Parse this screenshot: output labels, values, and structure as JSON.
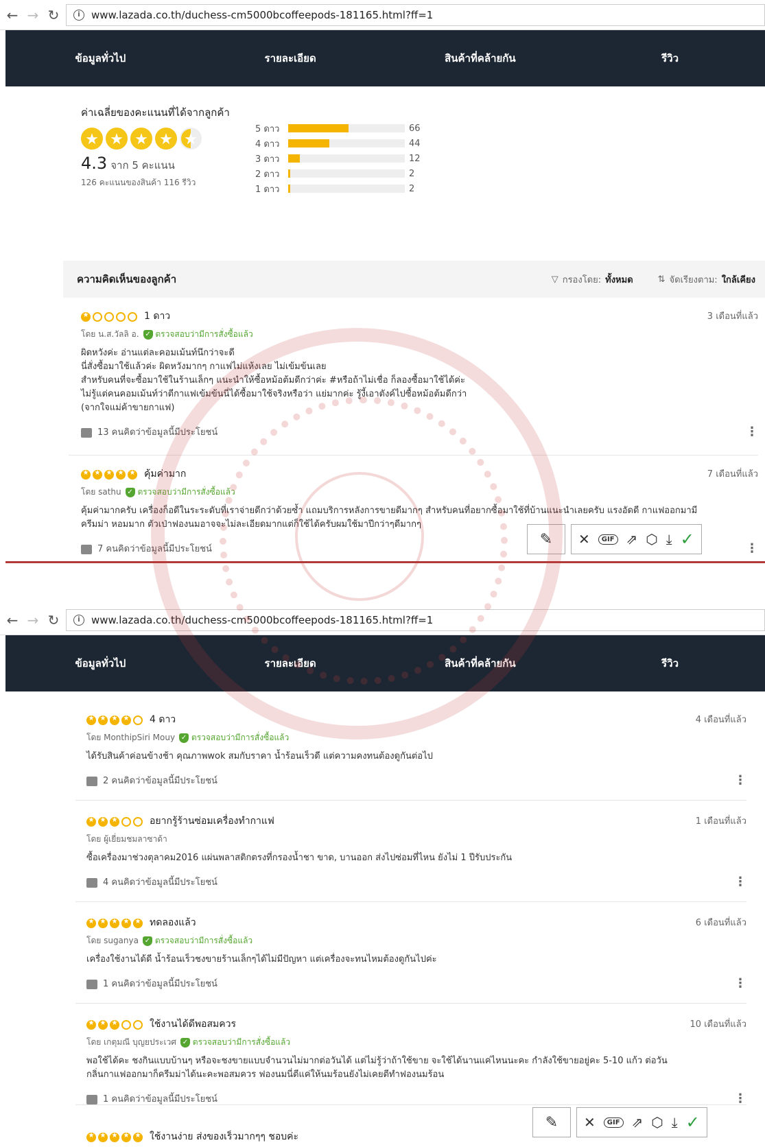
{
  "screen1": {
    "url": "www.lazada.co.th/duchess-cm5000bcoffeepods-181165.html?ff=1",
    "tabs": [
      "ข้อมูลทั่วไป",
      "รายละเอียด",
      "สินค้าที่คล้ายกัน",
      "รีวิว"
    ],
    "rating": {
      "heading": "ค่าเฉลี่ยของคะแนนที่ได้จากลูกค้า",
      "score": "4.3",
      "score_suffix": "จาก 5 คะแนน",
      "summary": "126 คะแนนของสินค้า 116 รีวิว",
      "stars": 4.3,
      "breakdown": [
        {
          "label": "5 ดาว",
          "count": 66,
          "fraction": 0.52
        },
        {
          "label": "4 ดาว",
          "count": 44,
          "fraction": 0.35
        },
        {
          "label": "3 ดาว",
          "count": 12,
          "fraction": 0.1
        },
        {
          "label": "2 ดาว",
          "count": 2,
          "fraction": 0.02
        },
        {
          "label": "1 ดาว",
          "count": 2,
          "fraction": 0.02
        }
      ]
    },
    "reviews_header": {
      "title": "ความคิดเห็นของลูกค้า",
      "filter_label": "กรองโดย:",
      "filter_value": "ทั้งหมด",
      "sort_label": "จัดเรียงตาม:",
      "sort_value": "ใกล้เคียง"
    },
    "reviews": [
      {
        "stars": 1,
        "title": "1 ดาว",
        "date": "3 เดือนที่แล้ว",
        "by": "โดย น.ส.วัลลิ อ.",
        "verified": "ตรวจสอบว่ามีการสั่งซื้อแล้ว",
        "body": "ผิดหวังค่ะ อ่านแต่ละคอมเม้นท์นึกว่าจะดี\nนี่สั่งซื้อมาใช้แล้วค่ะ ผิดหวังมากๆ กาแฟไม่แห้งเลย ไม่เข้มข้นเลย\nสำหรับคนที่จะซื้อมาใช้ในร้านเล็กๆ แนะนำให้ซื้อหม้อต้มดีกว่าค่ะ #หรือถ้าไม่เชื่อ ก็ลองซื้อมาใช้ได้ค่ะ\nไม่รู้แต่คนคอมเม้นท์ว่าตีกาแฟเข้มข้นนี่ได้ซื้อมาใช้จริงหรือว่า แย่มากค่ะ รู้งี้เอาตังค์ไปซื้อหม้อต้มดีกว่า\n(จากใจแม่ค้าขายกาแฟ)",
        "helpful": "13 คนคิดว่าข้อมูลนี้มีประโยชน์"
      },
      {
        "stars": 5,
        "title": "คุ้มค่ามาก",
        "date": "7 เดือนที่แล้ว",
        "by": "โดย sathu",
        "verified": "ตรวจสอบว่ามีการสั่งซื้อแล้ว",
        "body": "คุ้มค่ามากครับ เครื่องก็อดีในระระดับ​ที่เราจ่ายดีกว่าด้วยซ้ำ แถมบริการหลังการขายดีมากๆ สำหรับคนที่อยากซื้อมาใช้ที่บ้านแนะนำเลยครับ แรงอัดดี กาแฟออกมามี\nครีมม่า หอมมาก ตัวเป่าฟองนมอาจจะไม่ละเอียดมากแต่ก็ใช้ได้ครับผมใช้มาปีกว่าๆดีมากๆ",
        "helpful": "7 คนคิดว่าข้อมูลนี้มีประโยชน์"
      }
    ]
  },
  "screen2": {
    "url": "www.lazada.co.th/duchess-cm5000bcoffeepods-181165.html?ff=1",
    "tabs": [
      "ข้อมูลทั่วไป",
      "รายละเอียด",
      "สินค้าที่คล้ายกัน",
      "รีวิว"
    ],
    "reviews": [
      {
        "stars": 4,
        "title": "4 ดาว",
        "date": "4 เดือนที่แล้ว",
        "by": "โดย MonthipSiri Mouy",
        "verified": "ตรวจสอบว่ามีการสั่งซื้อแล้ว",
        "body": "ได้รับสินค้าค่อนข้างช้า คุณภาพwok สมกับราคา น้ำร้อนเร็วดี แต่ความคงทนต้องดูกันต่อไป",
        "helpful": "2 คนคิดว่าข้อมูลนี้มีประโยชน์"
      },
      {
        "stars": 3,
        "title": "อยากรู้ร้านซ่อมเครื่องทำกาแฟ",
        "date": "1 เดือนที่แล้ว",
        "by": "โดย ผู้เยี่ยมชมลาซาด้า",
        "verified": "",
        "body": "ซื้อเครื่องมาช่วงตุลาคม2016 แผ่นพลาสติกตรงที่กรองน้ำชา ขาด, บานออก ส่งไปซ่อมที่ไหน ยังไม่ 1 ปีรับประกัน",
        "helpful": "4 คนคิดว่าข้อมูลนี้มีประโยชน์"
      },
      {
        "stars": 5,
        "title": "ทดลองแล้ว",
        "date": "6 เดือนที่แล้ว",
        "by": "โดย suganya",
        "verified": "ตรวจสอบว่ามีการสั่งซื้อแล้ว",
        "body": "เครื่องใช้งานได้ดี น้ำร้อนเร็วชงขายร้านเล็กๆได้ไม่มีปัญหา แต่เครื่องจะทนไหมต้องดูกันไปค่ะ",
        "helpful": "1 คนคิดว่าข้อมูลนี้มีประโยชน์"
      },
      {
        "stars": 3,
        "title": "ใช้งานได้ดีพอสมควร",
        "date": "10 เดือนที่แล้ว",
        "by": "โดย เกตุมณี บุญยประเวศ",
        "verified": "ตรวจสอบว่ามีการสั่งซื้อแล้ว",
        "body": "พอใช้ได้คะ ชงกินแบบบ้านๆ หรือจะชงขายแบบจำนวนไม่มากต่อวันได้ แต่ไม่รู้ว่าถ้าใช้ขาย จะใช้ได้นานแค่ไหนนะคะ กำลังใช้ขายอยู่คะ 5-10 แก้ว ต่อวัน\nกลิ่นกาแฟออกมาก็ครีมม่าได้นะคะพอสมควร ฟองนมนี่ตีแค่ให้นมร้อนยังไม่เคยตีทำฟองนมร้อน",
        "helpful": "1 คนคิดว่าข้อมูลนี้มีประโยชน์"
      },
      {
        "stars": 5,
        "title": "ใช้งานง่าย ส่งของเร็วมากๆๆ ชอบค่ะ",
        "date": "",
        "by": "",
        "verified": "",
        "body": "",
        "helpful": ""
      }
    ]
  },
  "colors": {
    "nav_bg": "#1d2733",
    "star": "#f4b400",
    "verified": "#55a630",
    "watermark": "#c83c3c"
  },
  "icons": [
    "back-icon",
    "forward-icon",
    "reload-icon",
    "info-icon",
    "filter-icon",
    "sort-icon",
    "thumb-up-icon",
    "kebab-icon",
    "brush-icon",
    "close-icon",
    "gif-icon",
    "share-icon",
    "shield-icon",
    "download-icon",
    "check-icon"
  ]
}
